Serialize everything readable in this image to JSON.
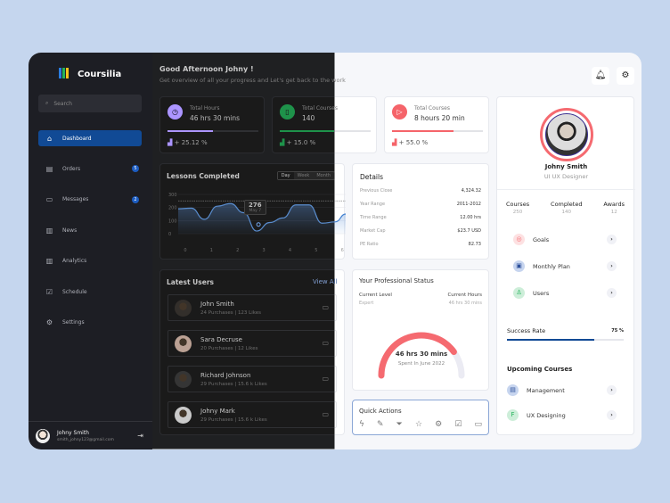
{
  "app": {
    "name": "Coursilia"
  },
  "sidebar": {
    "search_placeholder": "Search",
    "items": [
      {
        "label": "Dashboard",
        "icon": "home-icon",
        "active": true
      },
      {
        "label": "Orders",
        "icon": "orders-icon",
        "badge": "5"
      },
      {
        "label": "Messages",
        "icon": "messages-icon",
        "badge": "2"
      },
      {
        "label": "News",
        "icon": "news-icon"
      },
      {
        "label": "Analytics",
        "icon": "analytics-icon"
      },
      {
        "label": "Schedule",
        "icon": "schedule-icon"
      },
      {
        "label": "Settings",
        "icon": "settings-icon"
      }
    ],
    "user": {
      "name": "Johny Smith",
      "email": "smith_johny123@gmail.com"
    }
  },
  "header": {
    "greeting": "Good Afternoon Johny !",
    "subtitle": "Get overview of all your progress and Let's get back to the work"
  },
  "stats": [
    {
      "title": "Total Hours",
      "value": "46 hrs 30 mins",
      "change": "+ 25.12 %",
      "progress": 0.5,
      "color": "#5b3ff0"
    },
    {
      "title": "Total Courses",
      "value": "140",
      "change": "+ 15.0 %",
      "progress": 0.6,
      "color": "#23b35a"
    },
    {
      "title": "Total Courses",
      "value": "8 hours 20 min",
      "change": "+ 55.0 %",
      "progress": 0.68,
      "color": "#f5646a"
    }
  ],
  "lessons": {
    "title": "Lessons Completed",
    "tabs": [
      "Day",
      "Week",
      "Month"
    ],
    "tooltip_value": "276",
    "tooltip_label": "May 7"
  },
  "chart_data": {
    "type": "area",
    "title": "Lessons Completed",
    "x": [
      0,
      0.5,
      1,
      1.5,
      2,
      2.5,
      3,
      3.5,
      4,
      4.5,
      5,
      5.5,
      6,
      6.4
    ],
    "y": [
      190,
      195,
      110,
      210,
      230,
      160,
      20,
      85,
      120,
      220,
      220,
      80,
      90,
      150
    ],
    "xticks": [
      "0",
      "1",
      "2",
      "3",
      "4",
      "5",
      "6"
    ],
    "yticks": [
      "0",
      "100",
      "200",
      "300"
    ],
    "ylim": [
      0,
      300
    ],
    "reference_line": 250,
    "highlight": {
      "x": 3,
      "y": 276,
      "label": "May 7"
    }
  },
  "details": {
    "title": "Details",
    "rows": [
      {
        "label": "Previous Close",
        "value": "4,324.32"
      },
      {
        "label": "Year Range",
        "value": "2011-2012"
      },
      {
        "label": "Time Range",
        "value": "12.00 hrs"
      },
      {
        "label": "Market Cap",
        "value": "$23.7 USD"
      },
      {
        "label": "PE Ratio",
        "value": "82.73"
      }
    ]
  },
  "users": {
    "title": "Latest Users",
    "view_all": "View All",
    "items": [
      {
        "name": "John Smith",
        "meta": "24 Purchases | 123 Likes"
      },
      {
        "name": "Sara Decruse",
        "meta": "20 Purchases | 12 Likes"
      },
      {
        "name": "Richard Johnson",
        "meta": "29 Purchases | 15.6 k Likes"
      },
      {
        "name": "Johny Mark",
        "meta": "29 Purchases | 15.6 k Likes"
      }
    ]
  },
  "status": {
    "title": "Your Professional Status",
    "level_label": "Current Level",
    "level": "Expert",
    "hours_label": "Current Hours",
    "hours": "46 hrs 30 mins",
    "gauge_value": "46 hrs 30 mins",
    "gauge_caption": "Spent In June 2022",
    "gauge_fraction": 0.8
  },
  "quick": {
    "title": "Quick Actions",
    "icons": [
      "bolt-icon",
      "edit-icon",
      "filter-icon",
      "star-icon",
      "settings-icon",
      "calendar-check-icon",
      "comment-icon"
    ]
  },
  "profile": {
    "name": "Johny Smith",
    "role": "UI UX Designer",
    "stats": [
      {
        "label": "Courses",
        "value": "250"
      },
      {
        "label": "Completed",
        "value": "140"
      },
      {
        "label": "Awards",
        "value": "12"
      }
    ],
    "links": [
      {
        "label": "Goals"
      },
      {
        "label": "Monthly Plan"
      },
      {
        "label": "Users"
      }
    ],
    "success_label": "Success Rate",
    "success_value": "75 %",
    "success_fraction": 0.75,
    "upcoming_title": "Upcoming Courses",
    "upcoming": [
      {
        "label": "Management"
      },
      {
        "label": "UX Designing"
      }
    ]
  }
}
